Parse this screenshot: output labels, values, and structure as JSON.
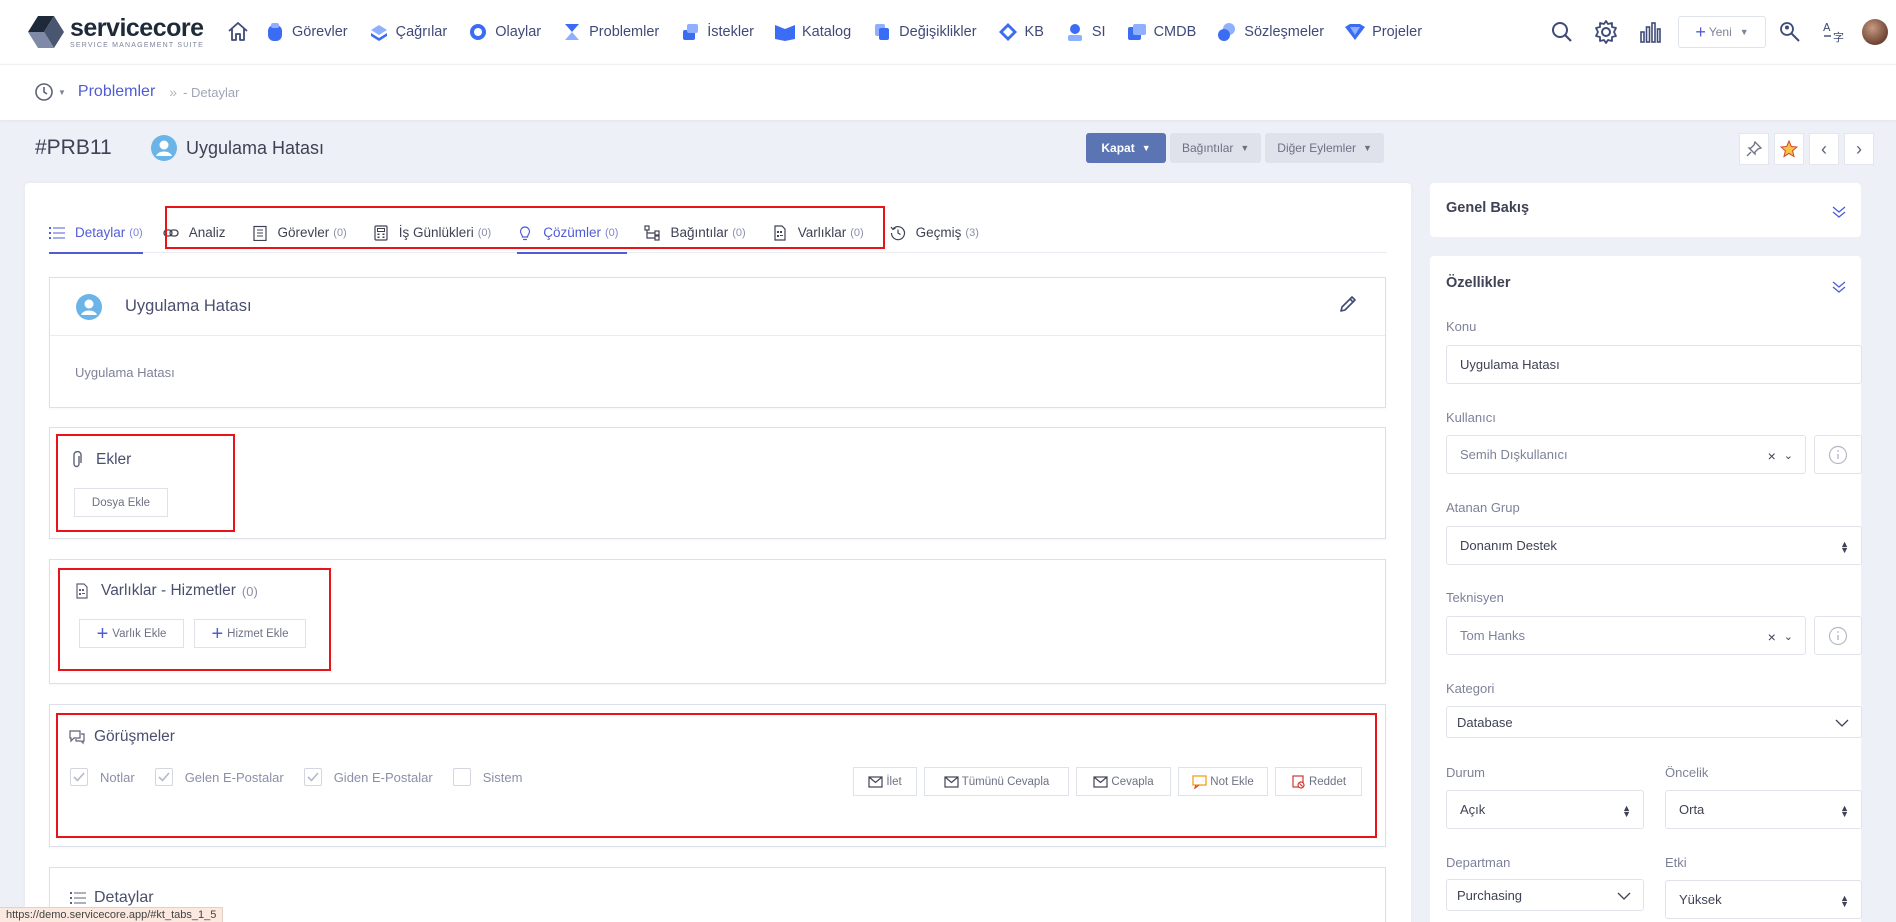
{
  "brand": {
    "name": "servicecore",
    "tagline": "SERVICE MANAGEMENT SUITE"
  },
  "nav": {
    "items": [
      {
        "label": "Görevler",
        "icon": "tasks-icon"
      },
      {
        "label": "Çağrılar",
        "icon": "calls-icon"
      },
      {
        "label": "Olaylar",
        "icon": "incidents-icon"
      },
      {
        "label": "Problemler",
        "icon": "problems-icon"
      },
      {
        "label": "İstekler",
        "icon": "requests-icon"
      },
      {
        "label": "Katalog",
        "icon": "catalog-icon"
      },
      {
        "label": "Değişiklikler",
        "icon": "changes-icon"
      },
      {
        "label": "KB",
        "icon": "kb-icon"
      },
      {
        "label": "SI",
        "icon": "si-icon"
      },
      {
        "label": "CMDB",
        "icon": "cmdb-icon"
      },
      {
        "label": "Sözleşmeler",
        "icon": "contracts-icon"
      },
      {
        "label": "Projeler",
        "icon": "projects-icon"
      }
    ],
    "new_label": "Yeni"
  },
  "breadcrumb": {
    "main": "Problemler",
    "sub": "- Detaylar"
  },
  "header": {
    "id": "#PRB11",
    "title": "Uygulama Hatası",
    "close_label": "Kapat",
    "relations_label": "Bağıntılar",
    "other_actions_label": "Diğer Eylemler"
  },
  "tabs": [
    {
      "label": "Detaylar",
      "count": "(0)"
    },
    {
      "label": "Analiz",
      "count": ""
    },
    {
      "label": "Görevler",
      "count": "(0)"
    },
    {
      "label": "İş Günlükleri",
      "count": "(0)"
    },
    {
      "label": "Çözümler",
      "count": "(0)"
    },
    {
      "label": "Bağıntılar",
      "count": "(0)"
    },
    {
      "label": "Varlıklar",
      "count": "(0)"
    },
    {
      "label": "Geçmiş",
      "count": "(3)"
    }
  ],
  "summary": {
    "title": "Uygulama Hatası",
    "description": "Uygulama Hatası"
  },
  "attachments": {
    "title": "Ekler",
    "add_file": "Dosya Ekle"
  },
  "assets": {
    "title": "Varlıklar - Hizmetler",
    "count": "(0)",
    "add_asset": "Varlık Ekle",
    "add_service": "Hizmet Ekle"
  },
  "conversations": {
    "title": "Görüşmeler",
    "filters": [
      {
        "label": "Notlar",
        "checked": true
      },
      {
        "label": "Gelen E-Postalar",
        "checked": true
      },
      {
        "label": "Giden E-Postalar",
        "checked": true
      },
      {
        "label": "Sistem",
        "checked": false
      }
    ],
    "actions": [
      {
        "label": "İlet",
        "icon": "forward-mail-icon"
      },
      {
        "label": "Tümünü Cevapla",
        "icon": "reply-all-mail-icon"
      },
      {
        "label": "Cevapla",
        "icon": "reply-mail-icon"
      },
      {
        "label": "Not Ekle",
        "icon": "add-note-icon"
      },
      {
        "label": "Reddet",
        "icon": "reject-icon"
      }
    ]
  },
  "details_section": {
    "title": "Detaylar"
  },
  "sidebar": {
    "overview_title": "Genel Bakış",
    "properties_title": "Özellikler",
    "subject_label": "Konu",
    "subject_value": "Uygulama Hatası",
    "user_label": "Kullanıcı",
    "user_value": "Semih Dışkullanıcı",
    "group_label": "Atanan Grup",
    "group_value": "Donanım Destek",
    "tech_label": "Teknisyen",
    "tech_value": "Tom Hanks",
    "category_label": "Kategori",
    "category_value": "Database",
    "status_label": "Durum",
    "status_value": "Açık",
    "priority_label": "Öncelik",
    "priority_value": "Orta",
    "department_label": "Departman",
    "department_value": "Purchasing",
    "impact_label": "Etki",
    "impact_value": "Yüksek"
  },
  "statusbar": {
    "url": "https://demo.servicecore.app/#kt_tabs_1_5"
  },
  "colors": {
    "accent": "#4f5cd6",
    "primary_button": "#5b74b3",
    "highlight": "#e8141a"
  }
}
